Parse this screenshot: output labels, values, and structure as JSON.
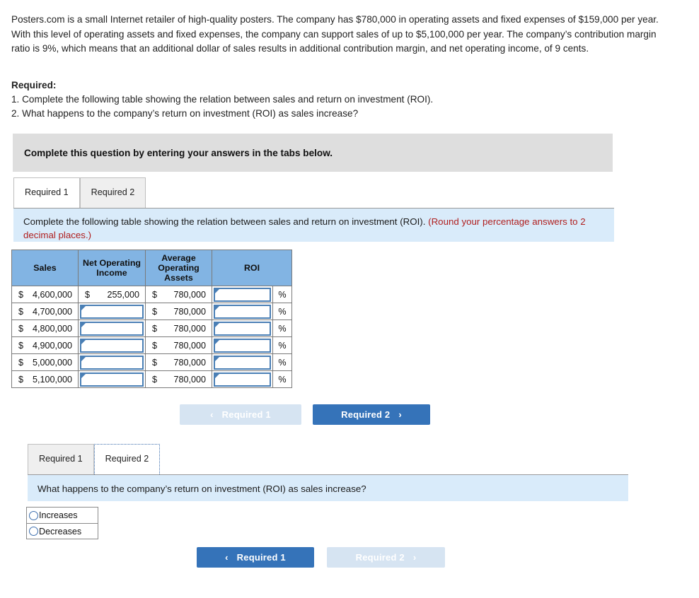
{
  "problem": {
    "paragraph": "Posters.com is a small Internet retailer of high-quality posters. The company has $780,000 in operating assets and fixed expenses of $159,000 per year. With this level of operating assets and fixed expenses, the company can support sales of up to $5,100,000 per year. The company’s contribution margin ratio is 9%, which means that an additional dollar of sales results in additional contribution margin, and net operating income, of 9 cents.",
    "required_title": "Required:",
    "required_1": "1. Complete the following table showing the relation between sales and return on investment (ROI).",
    "required_2": "2. What happens to the company’s return on investment (ROI) as sales increase?"
  },
  "banner": {
    "text": "Complete this question by entering your answers in the tabs below."
  },
  "tabs_top": [
    {
      "label": "Required 1",
      "state": "active"
    },
    {
      "label": "Required 2",
      "state": "inactive"
    }
  ],
  "tabs_bottom": [
    {
      "label": "Required 1",
      "state": "inactive"
    },
    {
      "label": "Required 2",
      "state": "focused"
    }
  ],
  "panel_required_1": {
    "instruction_main": "Complete the following table showing the relation between sales and return on investment (ROI).",
    "instruction_note": "(Round your percentage answers to 2 decimal places.)",
    "table": {
      "headers": [
        "Sales",
        "Net Operating Income",
        "Average Operating Assets",
        "ROI"
      ],
      "currency_symbol": "$",
      "percent_symbol": "%",
      "rows": [
        {
          "sales": "4,600,000",
          "net_operating_income": "255,000",
          "noi_input": false,
          "average_operating_assets": "780,000",
          "roi": ""
        },
        {
          "sales": "4,700,000",
          "net_operating_income": "",
          "noi_input": true,
          "average_operating_assets": "780,000",
          "roi": ""
        },
        {
          "sales": "4,800,000",
          "net_operating_income": "",
          "noi_input": true,
          "average_operating_assets": "780,000",
          "roi": ""
        },
        {
          "sales": "4,900,000",
          "net_operating_income": "",
          "noi_input": true,
          "average_operating_assets": "780,000",
          "roi": ""
        },
        {
          "sales": "5,000,000",
          "net_operating_income": "",
          "noi_input": true,
          "average_operating_assets": "780,000",
          "roi": ""
        },
        {
          "sales": "5,100,000",
          "net_operating_income": "",
          "noi_input": true,
          "average_operating_assets": "780,000",
          "roi": ""
        }
      ]
    },
    "nav": {
      "prev_label": "Required 1",
      "prev_state": "disabled",
      "next_label": "Required 2",
      "next_state": "enabled",
      "prev_chevron": "‹",
      "next_chevron": "›"
    }
  },
  "panel_required_2": {
    "instruction_main": "What happens to the company’s return on investment (ROI) as sales increase?",
    "options": [
      {
        "label": "Increases",
        "selected": false
      },
      {
        "label": "Decreases",
        "selected": false
      }
    ],
    "nav": {
      "prev_label": "Required 1",
      "prev_state": "enabled",
      "next_label": "Required 2",
      "next_state": "disabled",
      "prev_chevron": "‹",
      "next_chevron": "›"
    }
  },
  "colors": {
    "table_header_blue": "#82b4e3",
    "info_bar_blue": "#d9ebfa",
    "banner_gray": "#dedede",
    "button_blue": "#3573b9",
    "button_disabled_blue": "#d6e4f2",
    "note_red": "#b02020",
    "input_border_blue": "#4a7fb5"
  }
}
